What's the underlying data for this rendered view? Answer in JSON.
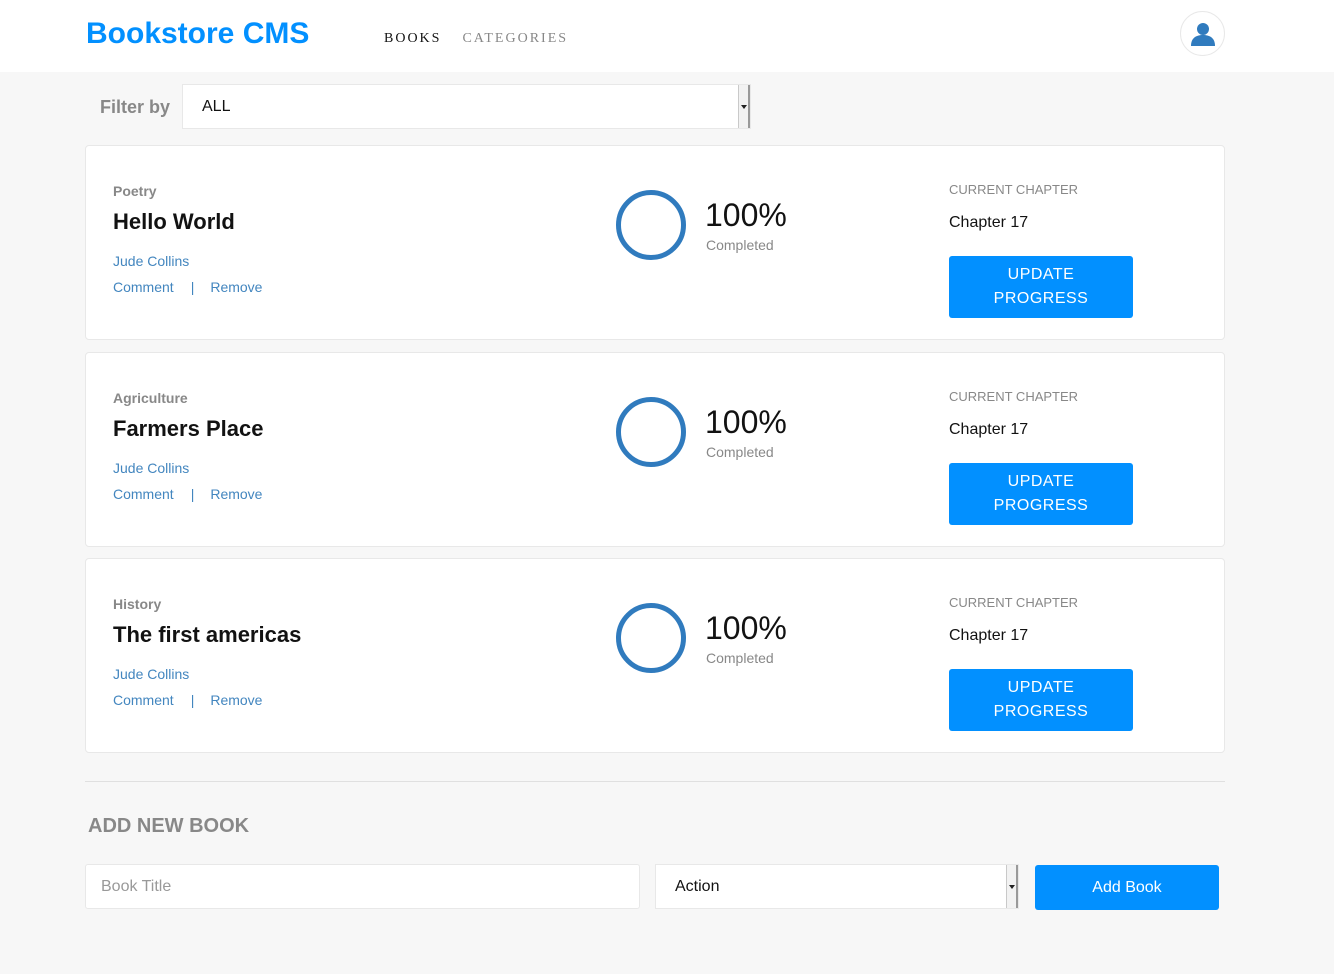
{
  "header": {
    "brand": "Bookstore CMS",
    "nav": {
      "books": "BOOKS",
      "categories": "CATEGORIES"
    },
    "avatar_icon": "user-icon"
  },
  "filter": {
    "label": "Filter by",
    "selected": "ALL"
  },
  "books": [
    {
      "genre": "Poetry",
      "title": "Hello World",
      "author": "Jude Collins",
      "comment": "Comment",
      "separator": "|",
      "remove": "Remove",
      "percent": "100%",
      "progress": 1.0,
      "completed": "Completed",
      "chapter_label": "CURRENT CHAPTER",
      "chapter": "Chapter 17",
      "update_line1": "UPDATE",
      "update_line2": "PROGRESS"
    },
    {
      "genre": "Agriculture",
      "title": "Farmers Place",
      "author": "Jude Collins",
      "comment": "Comment",
      "separator": "|",
      "remove": "Remove",
      "percent": "100%",
      "progress": 1.0,
      "completed": "Completed",
      "chapter_label": "CURRENT CHAPTER",
      "chapter": "Chapter 17",
      "update_line1": "UPDATE",
      "update_line2": "PROGRESS"
    },
    {
      "genre": "History",
      "title": "The first americas",
      "author": "Jude Collins",
      "comment": "Comment",
      "separator": "|",
      "remove": "Remove",
      "percent": "100%",
      "progress": 1.0,
      "completed": "Completed",
      "chapter_label": "CURRENT CHAPTER",
      "chapter": "Chapter 17",
      "update_line1": "UPDATE",
      "update_line2": "PROGRESS"
    }
  ],
  "add_book": {
    "heading": "ADD NEW BOOK",
    "title_placeholder": "Book Title",
    "category_selected": "Action",
    "submit": "Add Book"
  },
  "colors": {
    "accent": "#0290ff",
    "progress_ring": "#307bbe",
    "link": "#4386bf"
  }
}
